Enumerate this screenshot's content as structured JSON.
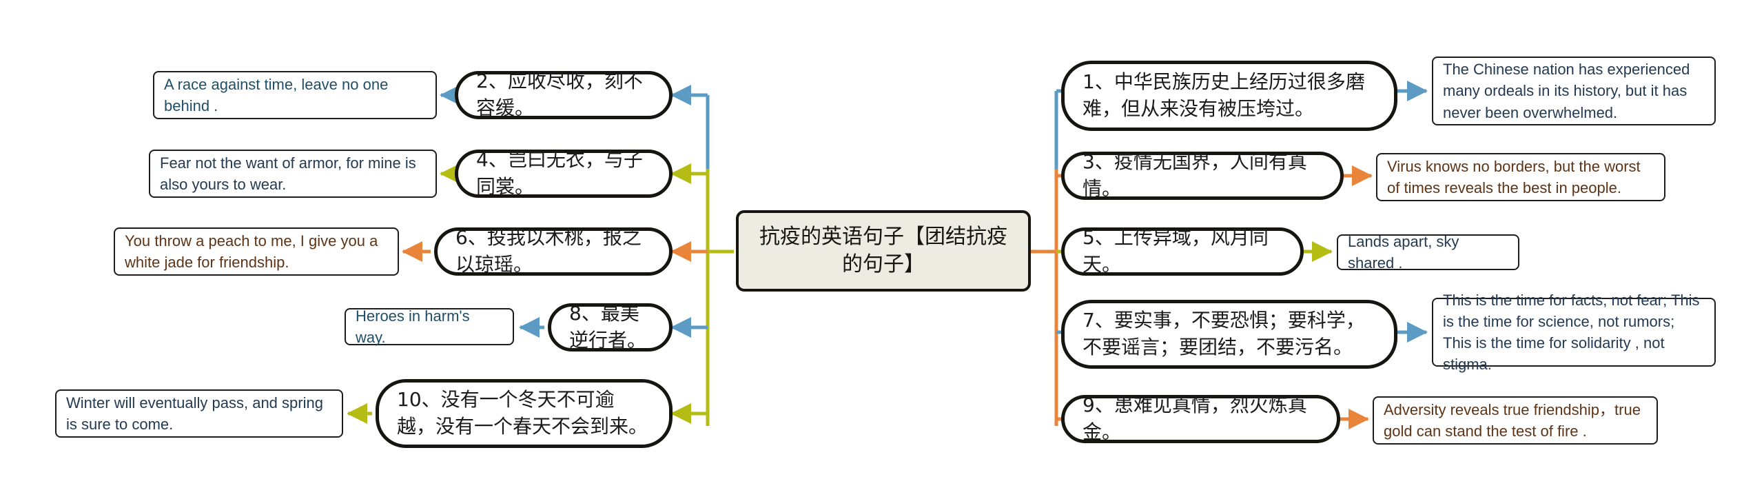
{
  "diagram": {
    "type": "mindmap",
    "title": "抗疫的英语句子【团结抗疫的句子】",
    "root": {
      "label": "抗疫的英语句子【团结抗疫的句子】"
    },
    "colors": {
      "blue": "#5b9bc4",
      "olive": "#b5bd15",
      "orange": "#e8853a",
      "root_fill": "#edece3",
      "node_stroke": "#17150f",
      "text_blue": "#1f4e68",
      "text_brown": "#5d3416",
      "text_dark_navy": "#243a52"
    },
    "left_branches": [
      {
        "cn": "2、应收尽收，刻不容缓。",
        "en": "A race against time, leave no one behind .",
        "arrow_color": "blue",
        "en_text_color": "blue"
      },
      {
        "cn": "4、岂曰无衣，与子同裳。",
        "en": "Fear not the want of armor, for mine is also yours to wear.",
        "arrow_color": "olive",
        "en_text_color": "dark"
      },
      {
        "cn": "6、投我以木桃，报之以琼瑶。",
        "en": "You throw a peach to me, I give you a white jade for friendship.",
        "arrow_color": "orange",
        "en_text_color": "brown"
      },
      {
        "cn": "8、最美逆行者。",
        "en": "Heroes in harm's way.",
        "arrow_color": "blue",
        "en_text_color": "blue"
      },
      {
        "cn": "10、没有一个冬天不可逾越，没有一个春天不会到来。",
        "en": "Winter will eventually pass, and spring is sure to come.",
        "arrow_color": "olive",
        "en_text_color": "dark"
      }
    ],
    "right_branches": [
      {
        "cn": "1、中华民族历史上经历过很多磨难，但从来没有被压垮过。",
        "en": "The Chinese nation has experienced many ordeals in its history, but it has never been overwhelmed.",
        "arrow_color": "blue",
        "en_text_color": "dark"
      },
      {
        "cn": "3、疫情无国界，人间有真情。",
        "en": "Virus knows no borders, but the worst of times reveals the best in people.",
        "arrow_color": "orange",
        "en_text_color": "brown"
      },
      {
        "cn": "5、上传异域，风月同天。",
        "en": "Lands apart, sky shared .",
        "arrow_color": "olive",
        "en_text_color": "dark"
      },
      {
        "cn": "7、要实事，不要恐惧；要科学，不要谣言；要团结，不要污名。",
        "en": "This is the time for facts, not fear; This is the time for science, not rumors; This is the time for solidarity , not stigma.",
        "arrow_color": "blue",
        "en_text_color": "dark"
      },
      {
        "cn": "9、患难见真情，烈火炼真金。",
        "en": "Adversity reveals true friendship，true gold can stand the test of fire .",
        "arrow_color": "orange",
        "en_text_color": "brown"
      }
    ]
  }
}
